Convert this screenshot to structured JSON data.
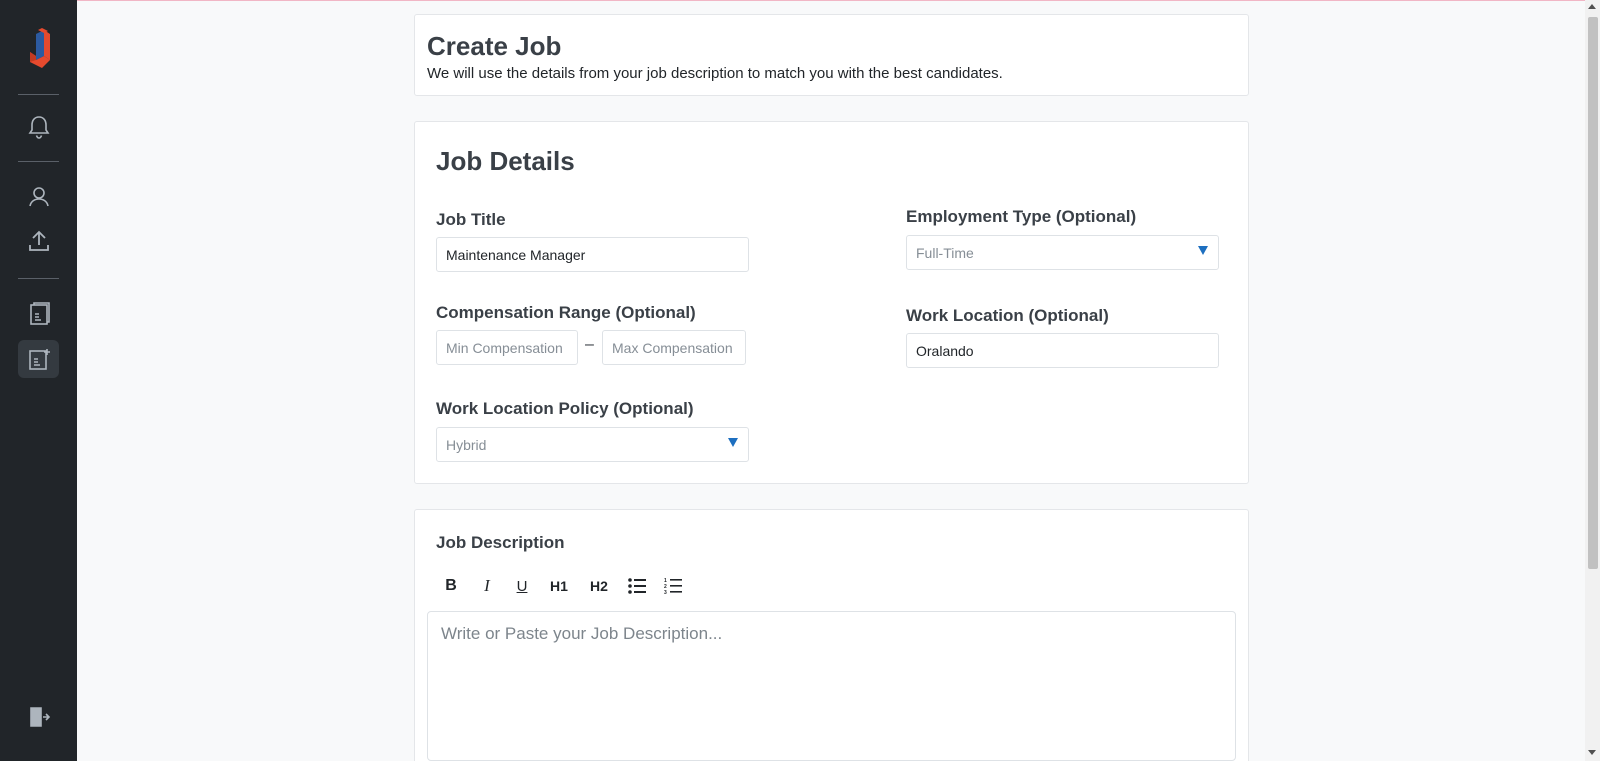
{
  "header": {
    "title": "Create Job",
    "subtitle": "We will use the details from your job description to match you with the best candidates."
  },
  "sidebar": {
    "items": [
      {
        "name": "notifications",
        "icon": "bell-icon"
      },
      {
        "name": "candidates",
        "icon": "user-icon"
      },
      {
        "name": "upload",
        "icon": "upload-icon"
      },
      {
        "name": "jobs",
        "icon": "document-icon"
      },
      {
        "name": "create-job",
        "icon": "document-add-icon",
        "active": true
      },
      {
        "name": "logout",
        "icon": "logout-icon"
      }
    ]
  },
  "job_details": {
    "title": "Job Details",
    "job_title_label": "Job Title",
    "job_title_value": "Maintenance Manager",
    "employment_type_label": "Employment Type (Optional)",
    "employment_type_value": "Full-Time",
    "compensation_label": "Compensation Range (Optional)",
    "min_compensation_placeholder": "Min Compensation",
    "compensation_separator": "–",
    "max_compensation_placeholder": "Max Compensation",
    "work_location_label": "Work Location (Optional)",
    "work_location_value": "Oralando",
    "work_location_policy_label": "Work Location Policy (Optional)",
    "work_location_policy_value": "Hybrid"
  },
  "job_description": {
    "title": "Job Description",
    "toolbar": {
      "bold": "B",
      "italic": "I",
      "underline": "U",
      "h1": "H1",
      "h2": "H2"
    },
    "placeholder": "Write or Paste your Job Description..."
  },
  "colors": {
    "sidebar_bg": "#212529",
    "accent": "#1d6fc0",
    "logo_red": "#e64a2e",
    "logo_blue": "#2c5aa0"
  }
}
